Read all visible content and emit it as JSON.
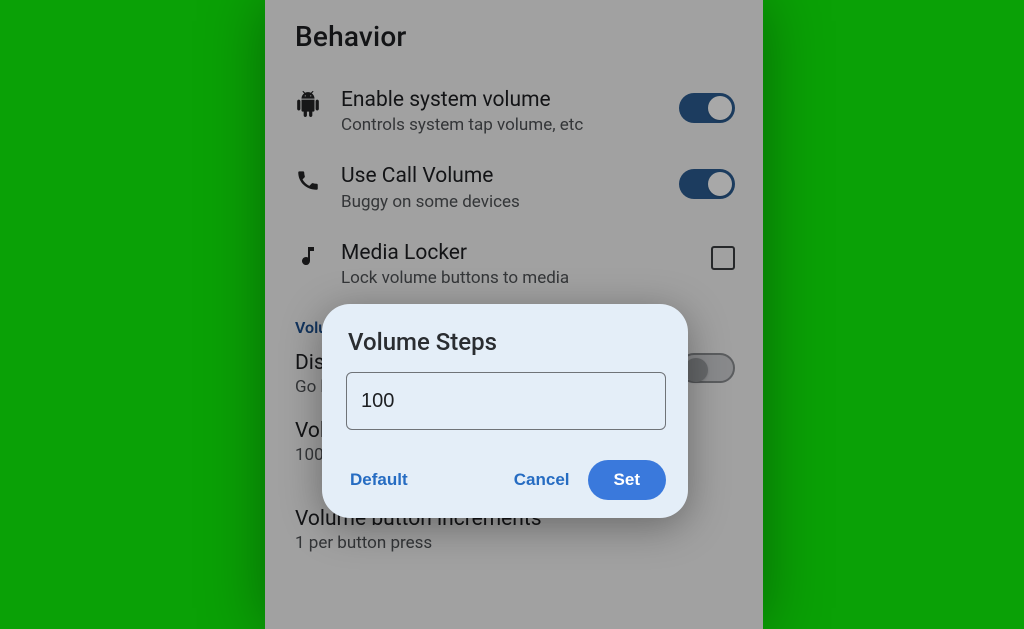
{
  "section": {
    "title": "Behavior"
  },
  "items": [
    {
      "icon": "android",
      "title": "Enable system volume",
      "sub": "Controls system tap volume, etc",
      "ctrl": "switch",
      "state": "on"
    },
    {
      "icon": "phone",
      "title": "Use Call Volume",
      "sub": "Buggy on some devices",
      "ctrl": "switch",
      "state": "on"
    },
    {
      "icon": "music",
      "title": "Media Locker",
      "sub": "Lock volume buttons to media",
      "ctrl": "checkbox",
      "state": "off"
    }
  ],
  "category": {
    "label_visible": "Volu"
  },
  "disabled_row": {
    "title_visible": "Disa",
    "sub_visible": "Go b",
    "switch_state": "off"
  },
  "volume_steps_row": {
    "title_visible": "Vol",
    "sub_visible": "100"
  },
  "increments_row": {
    "title": "Volume button increments",
    "sub": "1 per button press"
  },
  "dialog": {
    "title": "Volume Steps",
    "value": "100",
    "buttons": {
      "default": "Default",
      "cancel": "Cancel",
      "set": "Set"
    }
  }
}
